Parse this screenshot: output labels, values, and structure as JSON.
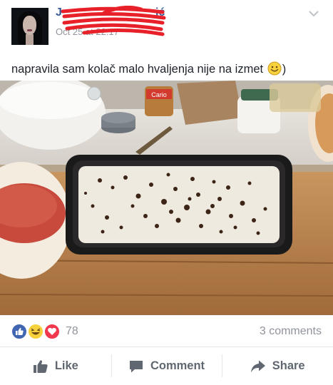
{
  "post": {
    "author": {
      "name": "J",
      "name_suffix": "ić",
      "timestamp": "Oct 25 at 22:17"
    },
    "text": "napravila sam kolač malo hvaljenja nije na izmet",
    "text_emoji": "smiley-icon",
    "text_suffix": ")",
    "photo_label": "Cario"
  },
  "reactions": {
    "icons": [
      "like-icon",
      "haha-icon",
      "love-icon"
    ],
    "count": "78"
  },
  "comments": {
    "count_label": "3 comments"
  },
  "actions": {
    "like_label": "Like",
    "comment_label": "Comment",
    "share_label": "Share"
  },
  "colors": {
    "like_blue": "#4267b2",
    "haha_yellow": "#f7d23d",
    "love_red": "#f0394d",
    "scribble_red": "#e8202a",
    "name_blue": "#385898",
    "muted_text": "#90949c",
    "action_text": "#606770"
  }
}
